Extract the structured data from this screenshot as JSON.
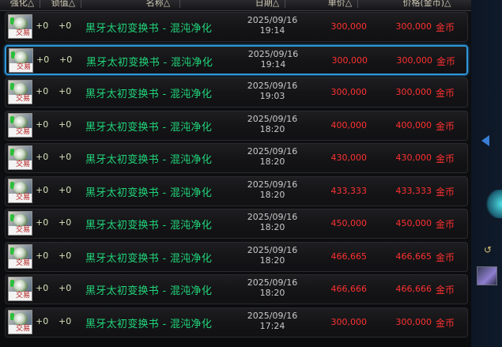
{
  "header": {
    "cols": [
      "强化△",
      "锁值△",
      "名称△",
      "日期△",
      "单价△",
      "价格(金币)△"
    ]
  },
  "rows": [
    {
      "icon_tag": "交易",
      "enhance": "+0",
      "lock": "+0",
      "name": "黑牙太初变换书 - 混沌净化",
      "date": "2025/09/16",
      "time": "19:14",
      "unit_price": "300,000",
      "total_price": "300,000",
      "currency": "金币",
      "selected": false
    },
    {
      "icon_tag": "交易",
      "enhance": "+0",
      "lock": "+0",
      "name": "黑牙太初变换书 - 混沌净化",
      "date": "2025/09/16",
      "time": "19:14",
      "unit_price": "300,000",
      "total_price": "300,000",
      "currency": "金币",
      "selected": true
    },
    {
      "icon_tag": "交易",
      "enhance": "+0",
      "lock": "+0",
      "name": "黑牙太初变换书 - 混沌净化",
      "date": "2025/09/16",
      "time": "19:03",
      "unit_price": "300,000",
      "total_price": "300,000",
      "currency": "金币",
      "selected": false
    },
    {
      "icon_tag": "交易",
      "enhance": "+0",
      "lock": "+0",
      "name": "黑牙太初变换书 - 混沌净化",
      "date": "2025/09/16",
      "time": "18:20",
      "unit_price": "400,000",
      "total_price": "400,000",
      "currency": "金币",
      "selected": false
    },
    {
      "icon_tag": "交易",
      "enhance": "+0",
      "lock": "+0",
      "name": "黑牙太初变换书 - 混沌净化",
      "date": "2025/09/16",
      "time": "18:20",
      "unit_price": "430,000",
      "total_price": "430,000",
      "currency": "金币",
      "selected": false
    },
    {
      "icon_tag": "交易",
      "enhance": "+0",
      "lock": "+0",
      "name": "黑牙太初变换书 - 混沌净化",
      "date": "2025/09/16",
      "time": "18:20",
      "unit_price": "433,333",
      "total_price": "433,333",
      "currency": "金币",
      "selected": false
    },
    {
      "icon_tag": "交易",
      "enhance": "+0",
      "lock": "+0",
      "name": "黑牙太初变换书 - 混沌净化",
      "date": "2025/09/16",
      "time": "18:20",
      "unit_price": "450,000",
      "total_price": "450,000",
      "currency": "金币",
      "selected": false
    },
    {
      "icon_tag": "交易",
      "enhance": "+0",
      "lock": "+0",
      "name": "黑牙太初变换书 - 混沌净化",
      "date": "2025/09/16",
      "time": "18:20",
      "unit_price": "466,665",
      "total_price": "466,665",
      "currency": "金币",
      "selected": false
    },
    {
      "icon_tag": "交易",
      "enhance": "+0",
      "lock": "+0",
      "name": "黑牙太初变换书 - 混沌净化",
      "date": "2025/09/16",
      "time": "18:20",
      "unit_price": "466,666",
      "total_price": "466,666",
      "currency": "金币",
      "selected": false
    },
    {
      "icon_tag": "交易",
      "enhance": "+0",
      "lock": "+0",
      "name": "黑牙太初变换书 - 混沌净化",
      "date": "2025/09/16",
      "time": "17:24",
      "unit_price": "300,000",
      "total_price": "300,000",
      "currency": "金币",
      "selected": false
    }
  ],
  "side": {
    "small_glyph": "↺"
  },
  "colors": {
    "name_text": "#21d47a",
    "price_text": "#ff3131",
    "selected_border": "#2f97d9"
  }
}
